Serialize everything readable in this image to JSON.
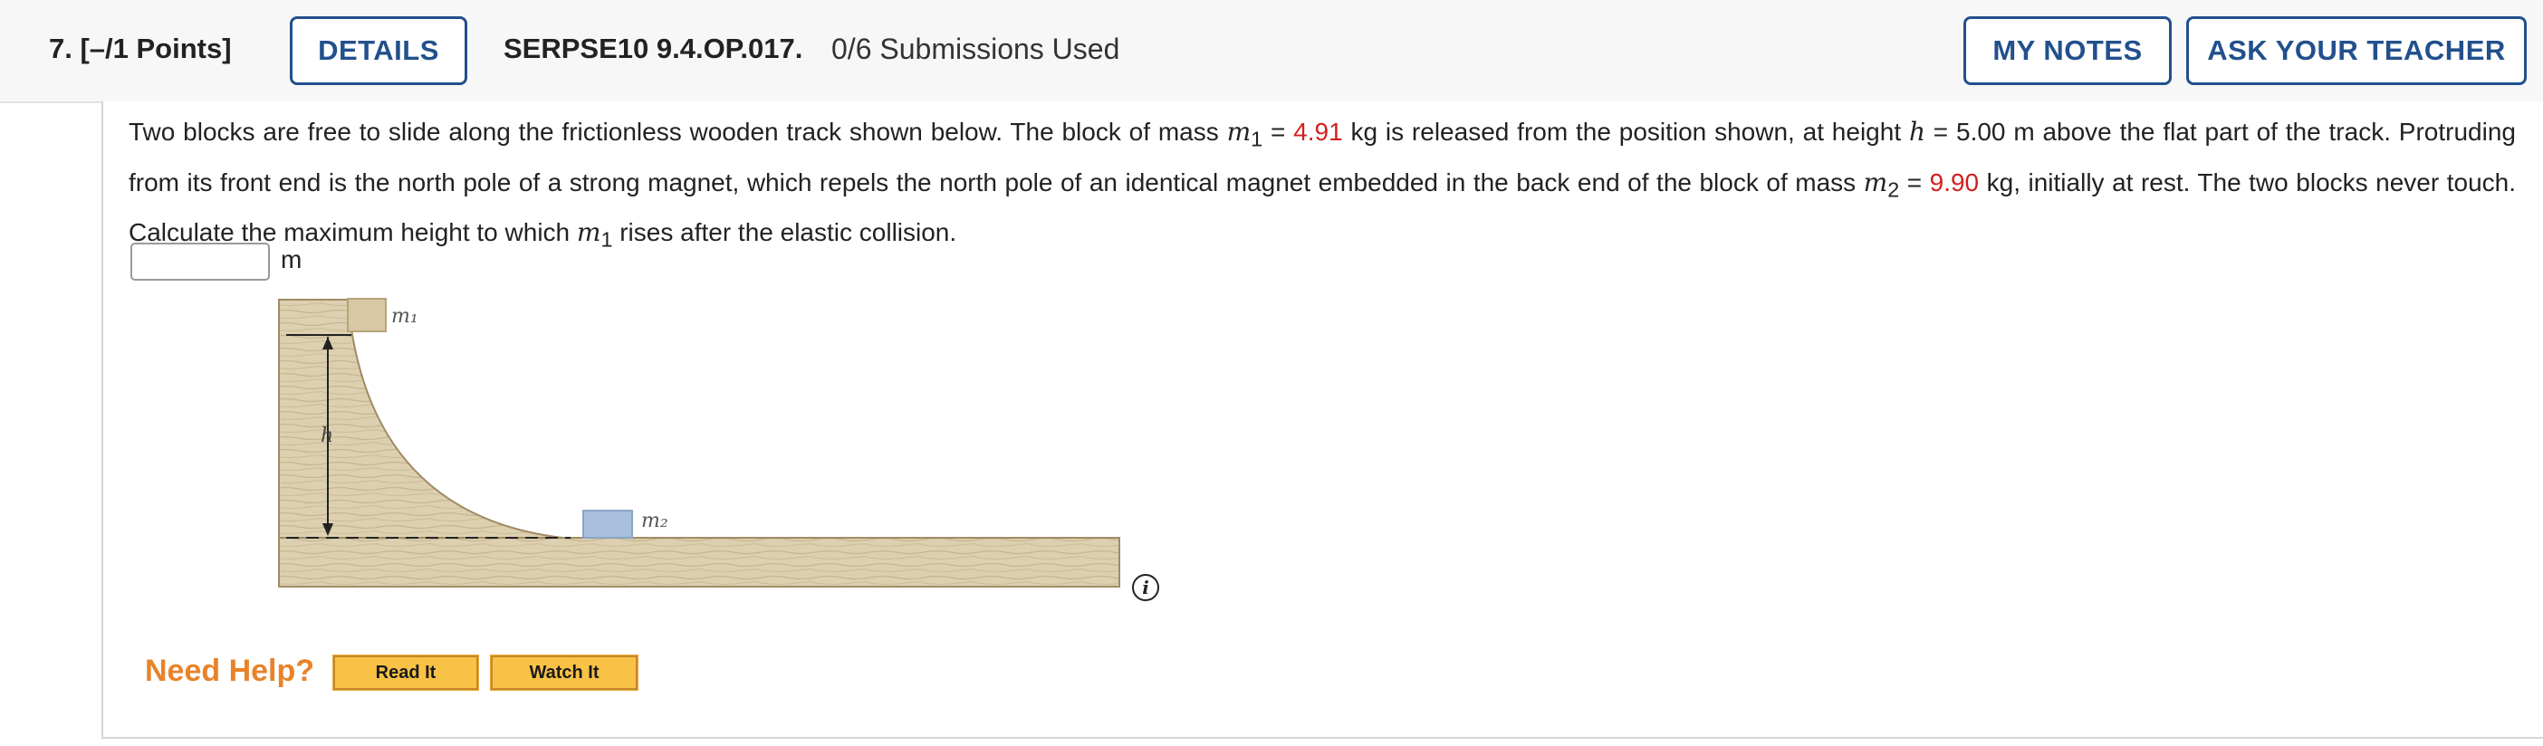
{
  "header": {
    "question_number": "7.  [–/1 Points]",
    "details_label": "DETAILS",
    "code": "SERPSE10 9.4.OP.017.",
    "submissions": "0/6 Submissions Used",
    "my_notes_label": "MY NOTES",
    "ask_teacher_label": "ASK YOUR TEACHER"
  },
  "problem": {
    "t1": "Two blocks are free to slide along the frictionless wooden track shown below. The block of mass ",
    "m1_symbol": "m",
    "m1_sub": "1",
    "eq1": " = ",
    "m1_value": "4.91",
    "t2": " kg is released from the position shown, at height ",
    "h_symbol": "h",
    "t3": " = 5.00 m above the flat part of the track. Protruding from its front end is the north pole of a strong magnet, which repels the north pole of an identical magnet embedded in the back end of the block of mass ",
    "m2_symbol": "m",
    "m2_sub": "2",
    "eq2": " = ",
    "m2_value": "9.90",
    "t4": " kg, initially at rest. The two blocks never touch. Calculate the maximum height to which ",
    "m1b_symbol": "m",
    "m1b_sub": "1",
    "t5": " rises after the elastic collision."
  },
  "answer": {
    "value": "",
    "unit": "m"
  },
  "figure": {
    "label_m1": "m₁",
    "label_m2": "m₂",
    "label_h": "h",
    "wood_color": "#ddd0b0",
    "block1_color": "#d9c8a4",
    "block2_color": "#a9c0dd"
  },
  "info_icon": "info-icon",
  "help": {
    "label": "Need Help?",
    "read_it": "Read It",
    "watch_it": "Watch It"
  }
}
